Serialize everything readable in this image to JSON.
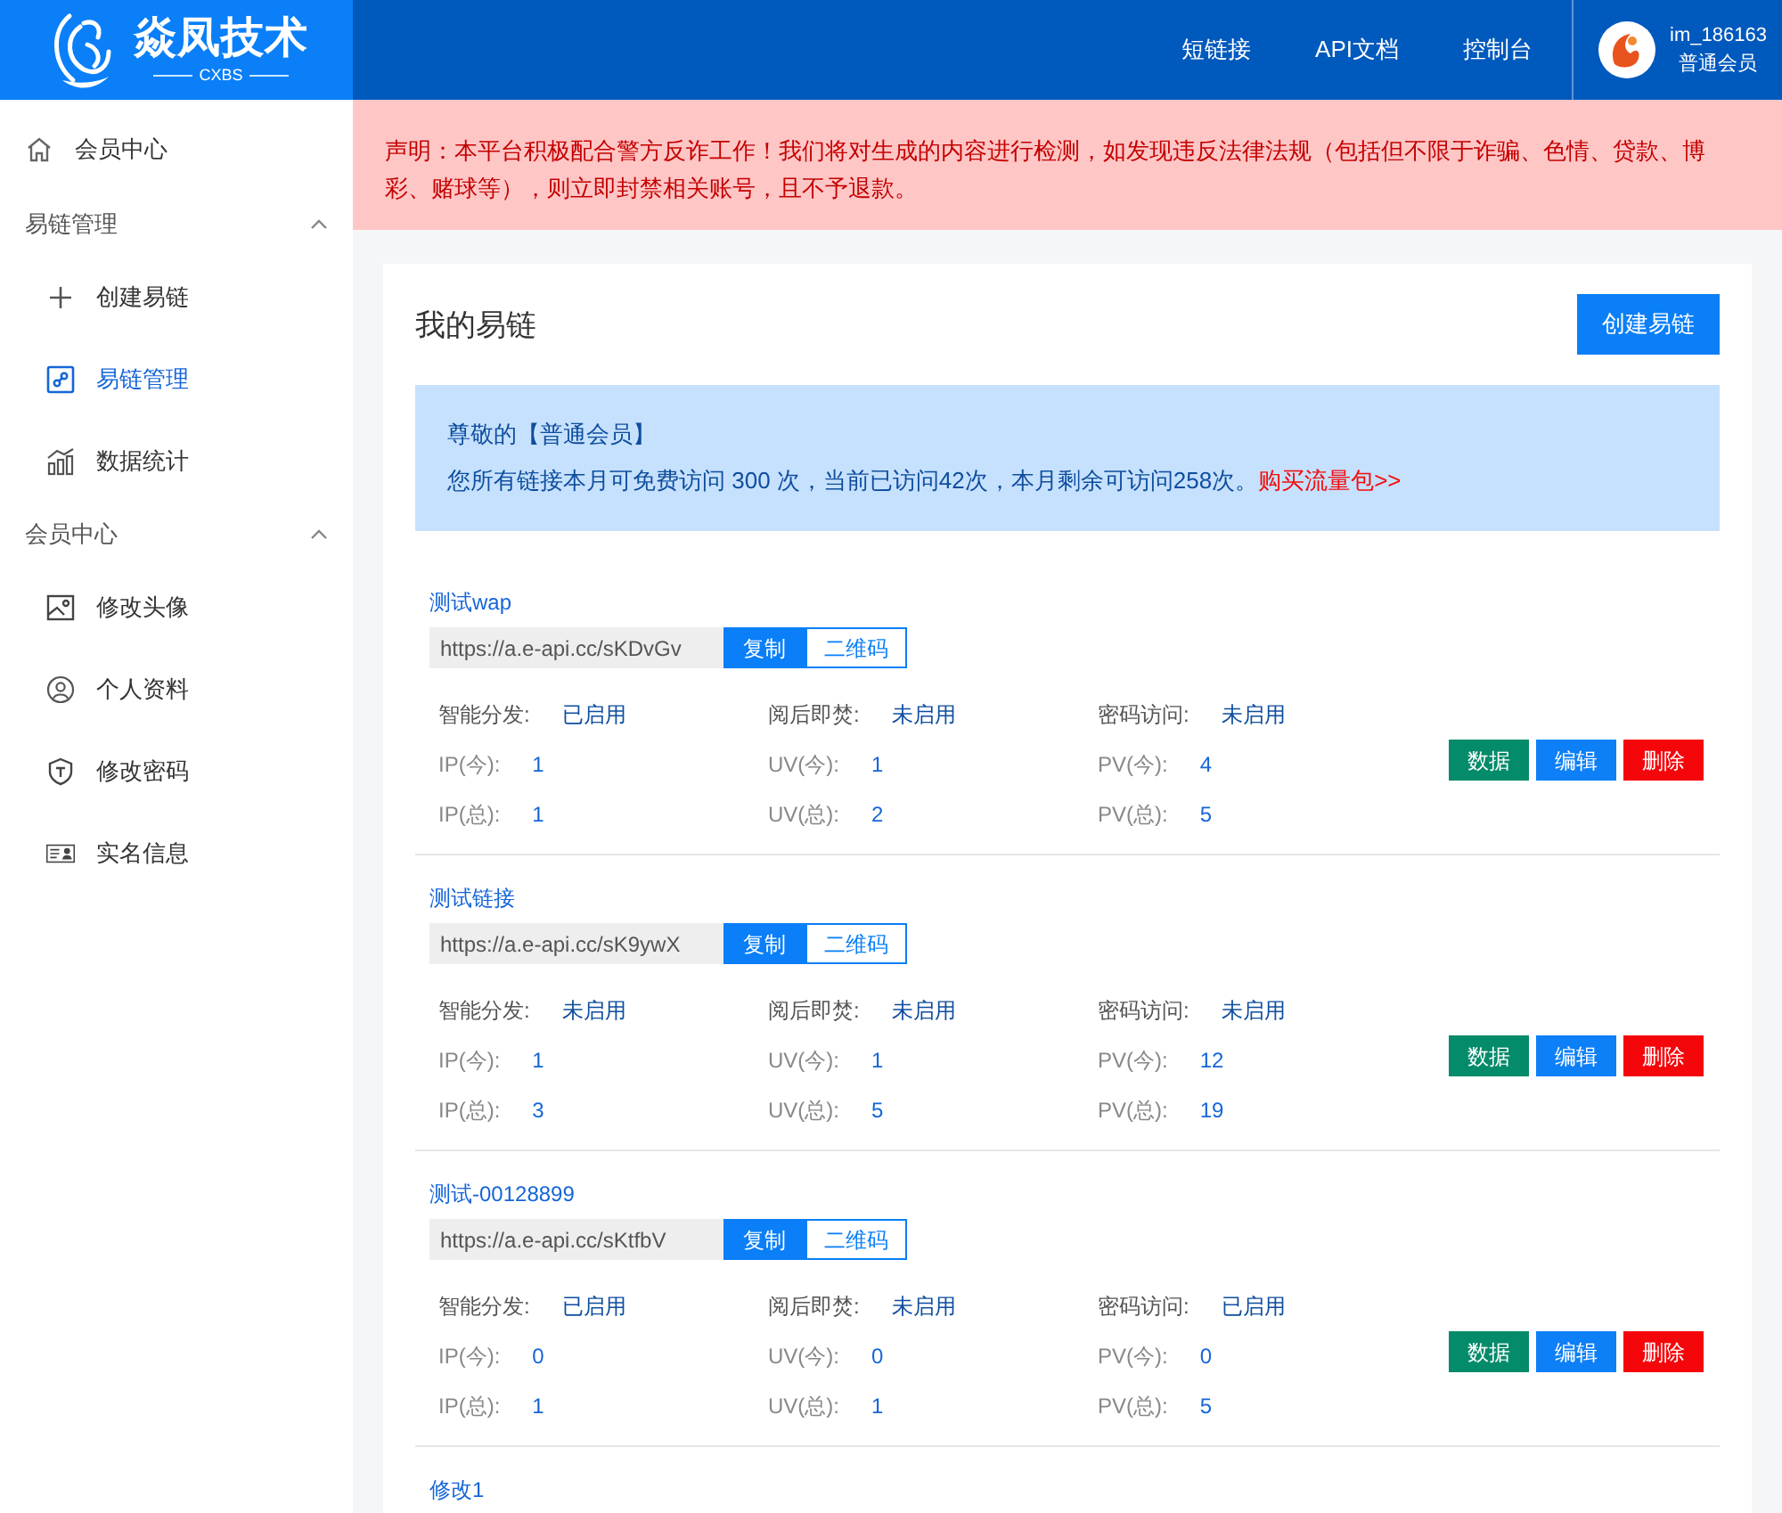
{
  "header": {
    "logo": {
      "name": "焱凤技术",
      "sub": "CXBS"
    },
    "nav": [
      {
        "label": "短链接"
      },
      {
        "label": "API文档"
      },
      {
        "label": "控制台"
      }
    ],
    "user": {
      "name": "im_186163",
      "level": "普通会员"
    }
  },
  "sidebar": [
    {
      "kind": "item",
      "label": "会员中心",
      "selected": false
    },
    {
      "kind": "group",
      "label": "易链管理",
      "expanded": true,
      "children": [
        {
          "label": "创建易链",
          "selected": false
        },
        {
          "label": "易链管理",
          "selected": true
        },
        {
          "label": "数据统计",
          "selected": false
        }
      ]
    },
    {
      "kind": "group",
      "label": "会员中心",
      "expanded": true,
      "children": [
        {
          "label": "修改头像",
          "selected": false
        },
        {
          "label": "个人资料",
          "selected": false
        },
        {
          "label": "修改密码",
          "selected": false
        },
        {
          "label": "实名信息",
          "selected": false
        }
      ]
    }
  ],
  "notice": "声明：本平台积极配合警方反诈工作！我们将对生成的内容进行检测，如发现违反法律法规（包括但不限于诈骗、色情、贷款、博彩、赌球等），则立即封禁相关账号，且不予退款。",
  "page": {
    "title": "我的易链",
    "create_button": "创建易链"
  },
  "info": {
    "greeting": "尊敬的【普通会员】",
    "text": "您所有链接本月可免费访问 300 次，当前已访问42次，本月剩余可访问258次。",
    "link": "购买流量包>>"
  },
  "links": [
    {
      "title": "测试wap",
      "url": "https://a.e-api.cc/sKDvGv",
      "copy": "复制",
      "qr": "二维码",
      "stats": [
        {
          "label": "智能分发:",
          "value": "已启用"
        },
        {
          "label": "阅后即焚:",
          "value": "未启用"
        },
        {
          "label": "密码访问:",
          "value": "未启用"
        },
        {
          "label": "IP(今):",
          "value": "1"
        },
        {
          "label": "UV(今):",
          "value": "1"
        },
        {
          "label": "PV(今):",
          "value": "4"
        },
        {
          "label": "IP(总):",
          "value": "1"
        },
        {
          "label": "UV(总):",
          "value": "2"
        },
        {
          "label": "PV(总):",
          "value": "5"
        }
      ],
      "actions": [
        {
          "label": "数据",
          "color": "#048b69"
        },
        {
          "label": "编辑",
          "color": "#0d7ff7"
        },
        {
          "label": "删除",
          "color": "#f5060b"
        }
      ]
    },
    {
      "title": "测试链接",
      "url": "https://a.e-api.cc/sK9ywX",
      "copy": "复制",
      "qr": "二维码",
      "stats": [
        {
          "label": "智能分发:",
          "value": "未启用"
        },
        {
          "label": "阅后即焚:",
          "value": "未启用"
        },
        {
          "label": "密码访问:",
          "value": "未启用"
        },
        {
          "label": "IP(今):",
          "value": "1"
        },
        {
          "label": "UV(今):",
          "value": "1"
        },
        {
          "label": "PV(今):",
          "value": "12"
        },
        {
          "label": "IP(总):",
          "value": "3"
        },
        {
          "label": "UV(总):",
          "value": "5"
        },
        {
          "label": "PV(总):",
          "value": "19"
        }
      ],
      "actions": [
        {
          "label": "数据",
          "color": "#048b69"
        },
        {
          "label": "编辑",
          "color": "#0d7ff7"
        },
        {
          "label": "删除",
          "color": "#f5060b"
        }
      ]
    },
    {
      "title": "测试-00128899",
      "url": "https://a.e-api.cc/sKtfbV",
      "copy": "复制",
      "qr": "二维码",
      "stats": [
        {
          "label": "智能分发:",
          "value": "已启用"
        },
        {
          "label": "阅后即焚:",
          "value": "未启用"
        },
        {
          "label": "密码访问:",
          "value": "已启用"
        },
        {
          "label": "IP(今):",
          "value": "0"
        },
        {
          "label": "UV(今):",
          "value": "0"
        },
        {
          "label": "PV(今):",
          "value": "0"
        },
        {
          "label": "IP(总):",
          "value": "1"
        },
        {
          "label": "UV(总):",
          "value": "1"
        },
        {
          "label": "PV(总):",
          "value": "5"
        }
      ],
      "actions": [
        {
          "label": "数据",
          "color": "#048b69"
        },
        {
          "label": "编辑",
          "color": "#0d7ff7"
        },
        {
          "label": "删除",
          "color": "#f5060b"
        }
      ]
    },
    {
      "title": "修改1"
    }
  ]
}
